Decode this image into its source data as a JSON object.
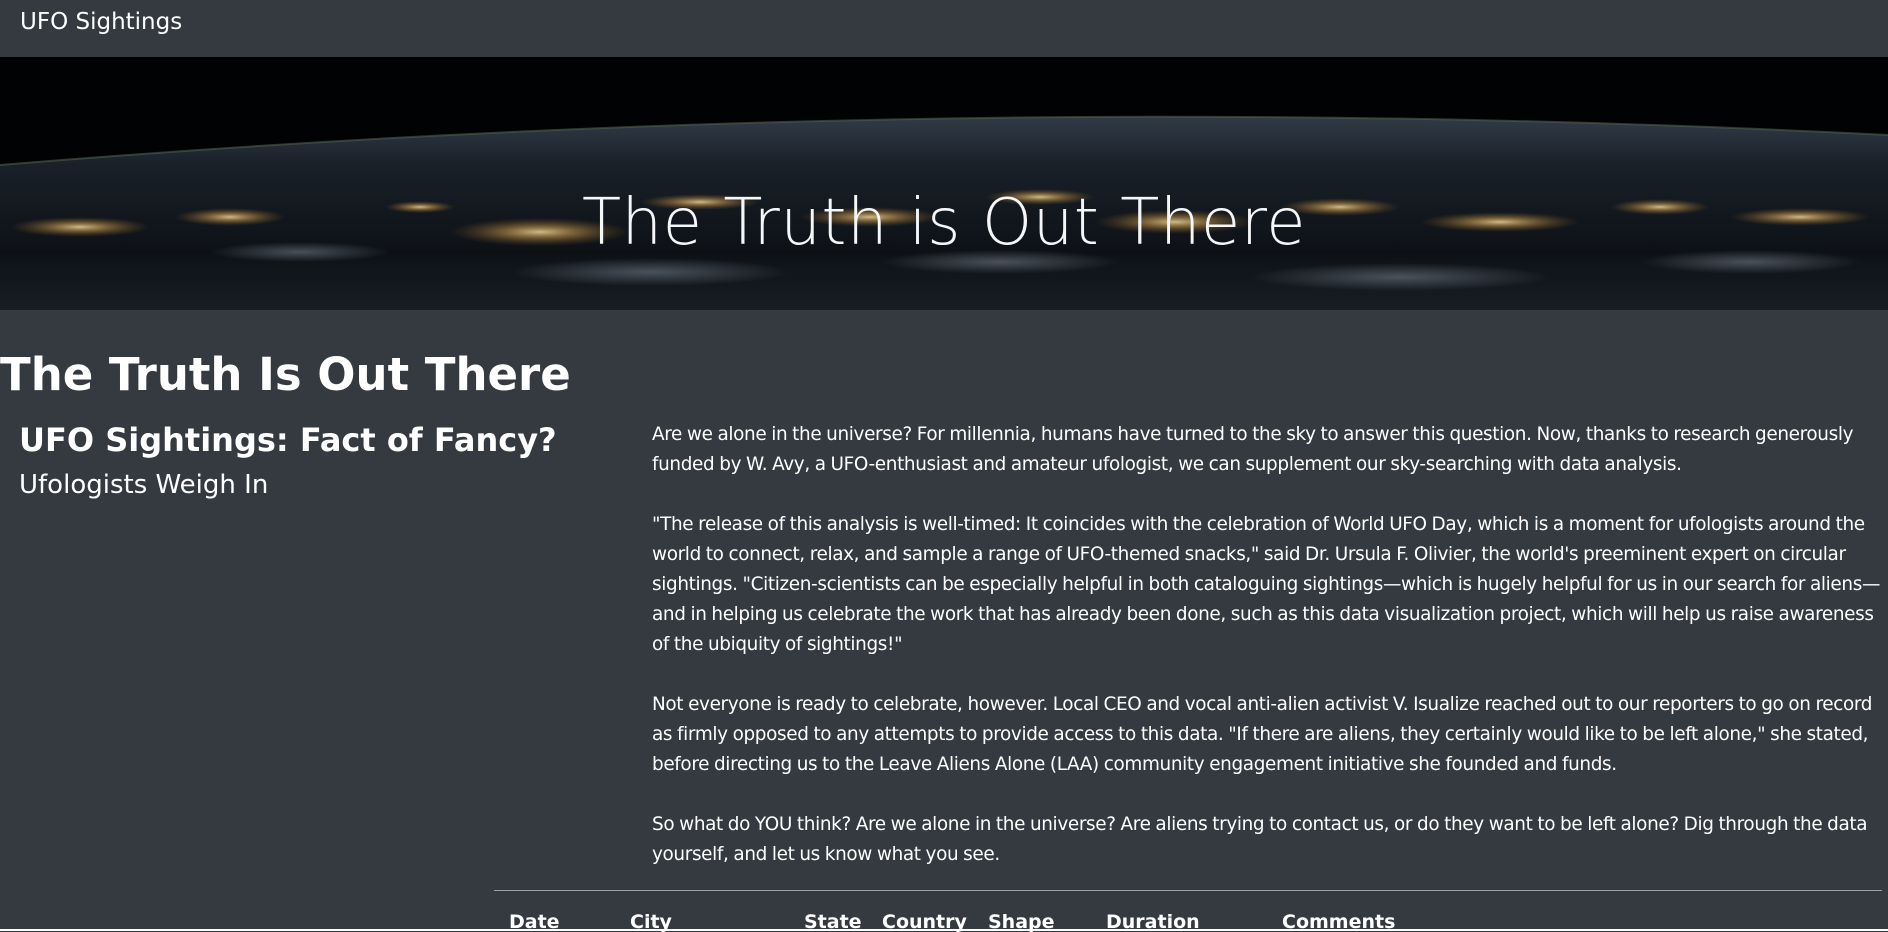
{
  "navbar": {
    "brand": "UFO Sightings"
  },
  "hero": {
    "title": "The Truth is Out There"
  },
  "main": {
    "heading": "The Truth Is Out There",
    "subheading": "UFO Sightings: Fact of Fancy?",
    "subsubheading": "Ufologists Weigh In",
    "paragraphs": [
      "Are we alone in the universe? For millennia, humans have turned to the sky to answer this question. Now, thanks to research generously funded by W. Avy, a UFO-enthusiast and amateur ufologist, we can supplement our sky-searching with data analysis.",
      "\"The release of this analysis is well-timed: It coincides with the celebration of World UFO Day, which is a moment for ufologists around the world to connect, relax, and sample a range of UFO-themed snacks,\" said Dr. Ursula F. Olivier, the world's preeminent expert on circular sightings. \"Citizen-scientists can be especially helpful in both cataloguing sightings—which is hugely helpful for us in our search for aliens—and in helping us celebrate the work that has already been done, such as this data visualization project, which will help us raise awareness of the ubiquity of sightings!\"",
      "Not everyone is ready to celebrate, however. Local CEO and vocal anti-alien activist V. Isualize reached out to our reporters to go on record as firmly opposed to any attempts to provide access to this data. \"If there are aliens, they certainly would like to be left alone,\" she stated, before directing us to the Leave Aliens Alone (LAA) community engagement initiative she founded and funds.",
      "So what do YOU think? Are we alone in the universe? Are aliens trying to contact us, or do they want to be left alone? Dig through the data yourself, and let us know what you see."
    ]
  },
  "table": {
    "columns": [
      "Date",
      "City",
      "State",
      "Country",
      "Shape",
      "Duration",
      "Comments"
    ]
  },
  "colors": {
    "background": "#343a40",
    "text": "#ffffff"
  }
}
